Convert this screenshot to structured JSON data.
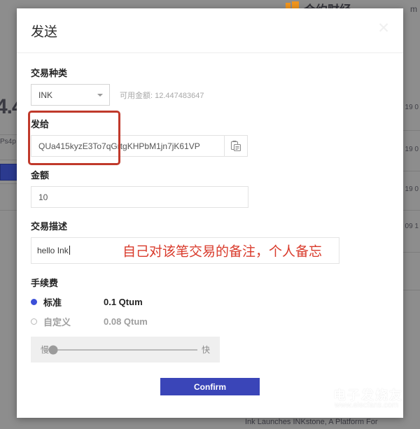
{
  "background": {
    "site_title": "合约财经",
    "logo_icon": "pinwheel-logo-icon",
    "top_right_fragment": "m",
    "left_fragments": {
      "big_number": "4.4",
      "text": "Ps4p"
    },
    "right_fragments": [
      "19 0",
      "19 0",
      "19 0",
      "09 1"
    ],
    "bottom_text": "Ink Launches INKstone, A Platform For"
  },
  "watermark": {
    "brand_cn": "电子发烧友",
    "url": "www.elecfans.com",
    "mark_icon": "circuit-node-icon"
  },
  "modal": {
    "title": "发送",
    "close_icon": "close-icon",
    "transaction_type": {
      "label": "交易种类",
      "selected": "INK",
      "caret_icon": "chevron-down-icon",
      "balance_text": "可用金额: 12.447483647",
      "highlight_color": "#c0392b"
    },
    "recipient": {
      "label": "发给",
      "value": "QUa415kyzE3To7qGrtgKHPbM1jn7jK61VP",
      "paste_icon": "clipboard-paste-icon"
    },
    "amount": {
      "label": "金额",
      "value": "10"
    },
    "description": {
      "label": "交易描述",
      "value": "hello Ink",
      "annotation": "自己对该笔交易的备注，个人备忘",
      "annotation_color": "#d93a2b"
    },
    "fee": {
      "label": "手续费",
      "options": [
        {
          "name": "标准",
          "amount": "0.1 Qtum",
          "selected": true
        },
        {
          "name": "自定义",
          "amount": "0.08 Qtum",
          "selected": false
        }
      ],
      "selected_color": "#3b4fd8",
      "slider": {
        "min_label": "慢",
        "max_label": "快",
        "position_percent": 0
      }
    },
    "confirm_label": "Confirm",
    "confirm_color": "#3a45b8"
  }
}
